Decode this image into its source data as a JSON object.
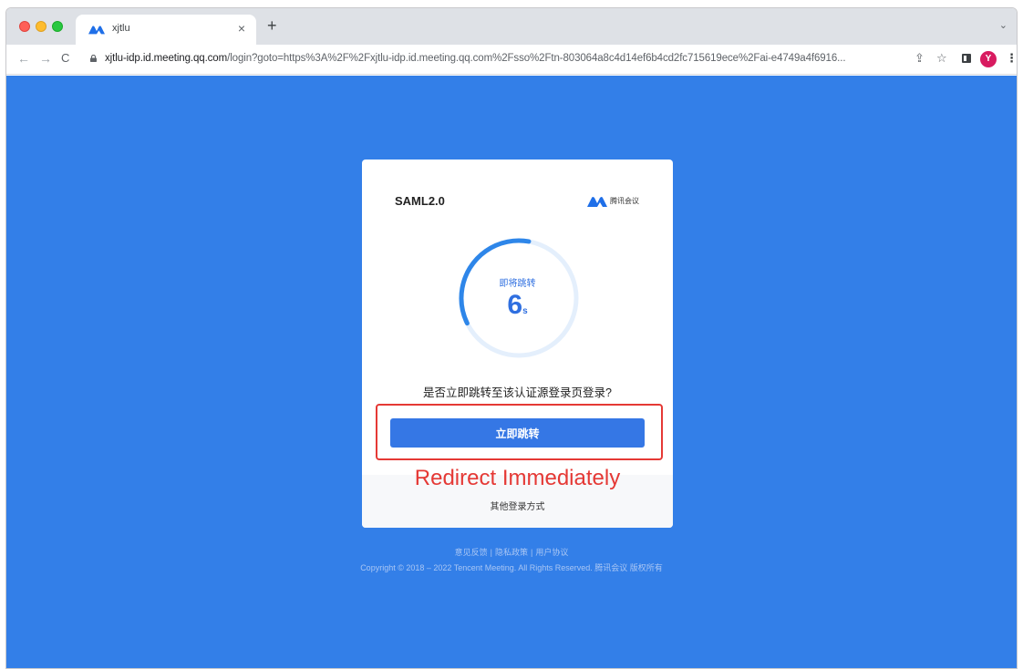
{
  "browser": {
    "tab_title": "xjtlu",
    "tab_close": "×",
    "new_tab": "+",
    "tab_dropdown": "⌄",
    "nav": {
      "back": "←",
      "forward": "→",
      "reload": "C"
    },
    "url_host": "xjtlu-idp.id.meeting.qq.com",
    "url_rest": "/login?goto=https%3A%2F%2Fxjtlu-idp.id.meeting.qq.com%2Fsso%2Ftn-803064a8c4d14ef6b4cd2fc715619ece%2Fai-e4749a4f6916...",
    "profile_initial": "Y",
    "menu": "⋮",
    "share": "⇪",
    "star": "☆"
  },
  "card": {
    "title": "SAML2.0",
    "brand_name": "腾讯会议",
    "ring_caption": "即将跳转",
    "countdown_value": "6",
    "countdown_unit": "s",
    "countdown_progress": 0.35,
    "question": "是否立即跳转至该认证源登录页登录?",
    "redirect_button": "立即跳转",
    "annotation": "Redirect Immediately",
    "other_login": "其他登录方式"
  },
  "footer": {
    "links": [
      "意见反馈",
      "隐私政策",
      "用户协议"
    ],
    "separator": "|",
    "copyright": "Copyright © 2018 – 2022 Tencent Meeting. All Rights Reserved. 腾讯会议 版权所有"
  },
  "colors": {
    "page_bg": "#337fe8",
    "accent": "#3577e5",
    "annotation_red": "#e53935",
    "ring_track": "#e4effc",
    "ring_progress": "#2e86e9"
  },
  "icons": {
    "tab_favicon": "tencent-meeting-icon",
    "lock": "lock-icon",
    "share": "share-icon",
    "star": "star-icon",
    "side_panel": "side-panel-icon",
    "menu": "kebab-menu-icon"
  }
}
